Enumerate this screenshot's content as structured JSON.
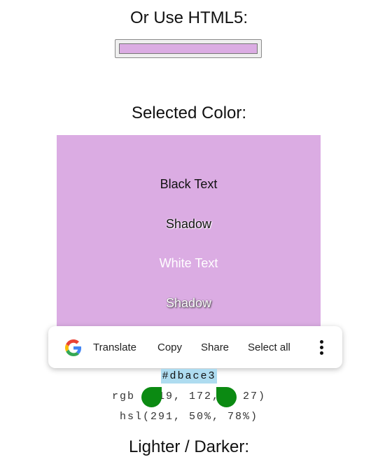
{
  "headings": {
    "html5": "Or Use HTML5:",
    "selected": "Selected Color:",
    "lighter_darker": "Lighter / Darker:"
  },
  "color_input": {
    "value": "#dbace3"
  },
  "preview": {
    "background": "#dbace3",
    "black_text": "Black Text",
    "black_shadow": "Shadow",
    "white_text": "White Text",
    "white_shadow": "Shadow"
  },
  "selection_toolbar": {
    "logo_icon": "google-g-icon",
    "translate": "Translate",
    "copy": "Copy",
    "share": "Share",
    "select_all": "Select all",
    "more_icon": "more-vertical-icon"
  },
  "values": {
    "hex": "#dbace3",
    "rgb_before": "rgb",
    "rgb_middle": "19, 172,",
    "rgb_after": "27)",
    "hsl": "hsl(291, 50%, 78%)"
  },
  "colors": {
    "selection_handle": "#0b8a12",
    "selection_highlight": "#aedcf0"
  }
}
